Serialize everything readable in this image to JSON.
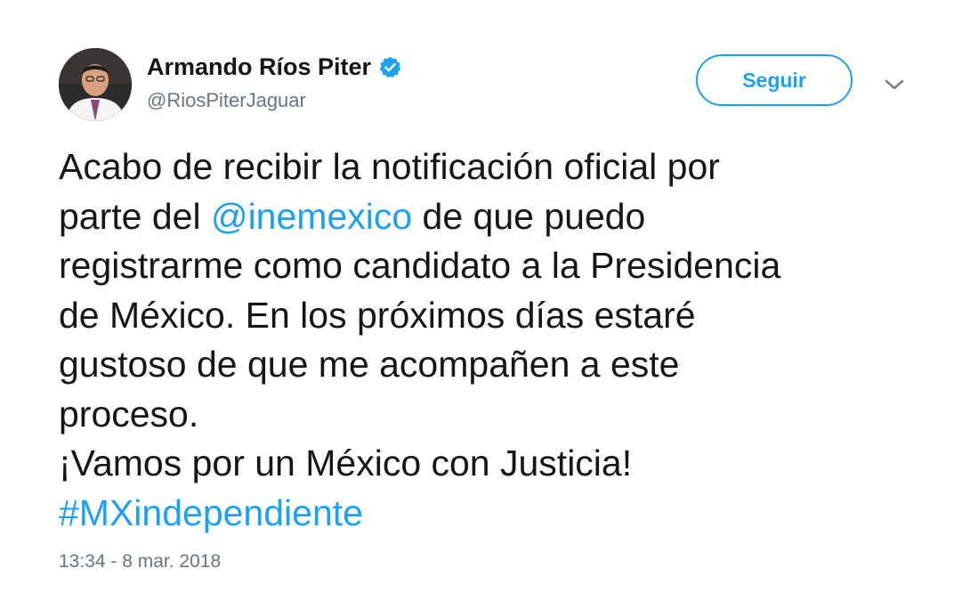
{
  "user": {
    "display_name": "Armando Ríos Piter",
    "handle": "@RiosPiterJaguar",
    "verified": true
  },
  "actions": {
    "follow_label": "Seguir"
  },
  "icons": {
    "verified": "verified-badge-icon",
    "more": "chevron-down-icon"
  },
  "tweet": {
    "line1": "Acabo de recibir la notificación oficial por",
    "line2_before": "parte del ",
    "mention": "@inemexico",
    "line2_after": " de que puedo",
    "line3": "registrarme como candidato a la Presidencia",
    "line4": "de México. En los próximos días estaré",
    "line5": "gustoso de que me acompañen a este",
    "line6": "proceso.",
    "line7": "¡Vamos por un México con Justicia!",
    "hashtag": "#MXindependiente"
  },
  "timestamp": "13:34 - 8 mar. 2018",
  "colors": {
    "accent": "#1da1f2",
    "text": "#14171a",
    "muted": "#657786"
  }
}
